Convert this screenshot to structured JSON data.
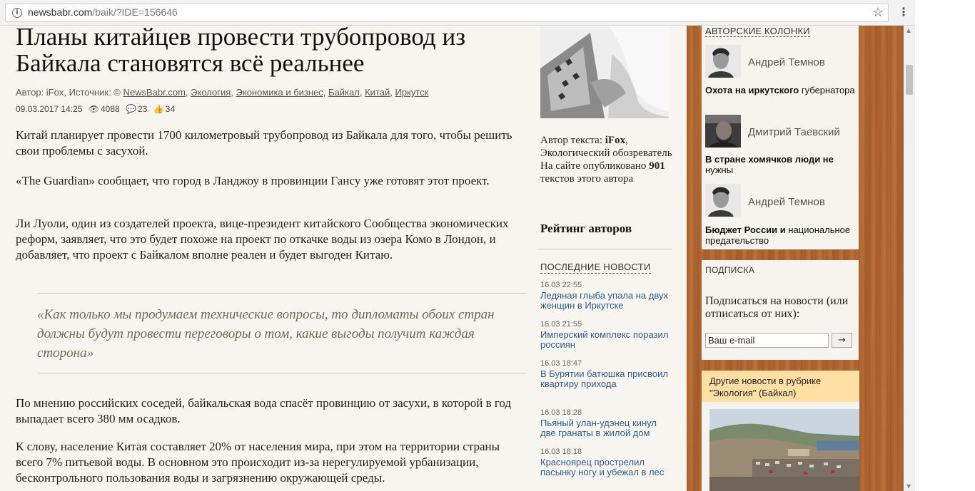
{
  "browser": {
    "url_host": "newsbabr.com",
    "url_path": "/baik/?IDE=156646",
    "info_icon": "info-icon",
    "star_icon": "star-icon",
    "menu_icon": "kebab-menu-icon"
  },
  "article": {
    "title": "Планы китайцев провести трубопровод из Байкала становятся всё реальнее",
    "meta_prefix": "Автор: iFox, Источник: © ",
    "source": "NewsBabr.com",
    "tags": [
      "Экология",
      "Экономика и бизнес",
      "Байкал",
      "Китай",
      "Иркутск"
    ],
    "date": "09.03.2017 14:25",
    "views": "4088",
    "comments": "23",
    "likes": "34",
    "paragraphs": [
      "Китай планирует провести 1700 километровый трубопровод из Байкала для того, чтобы решить свои проблемы с засухой.",
      "«The Guardian» сообщает, что город в Ланджоу в провинции Гансу уже готовят этот проект.",
      "Ли Луоли, один из создателей проекта, вице-президент китайского Сообщества экономических реформ, заявляет, что это будет похоже на проект по откачке воды из озера Комо в Лондон, и добавляет, что проект с Байкалом вполне реален и будет выгоден Китаю.",
      "По мнению российских соседей, байкальская вода спасёт провинцию от засухи, в которой в год выпадает всего 380 мм осадков.",
      "К слову, население Китая составляет 20% от населения мира, при этом на территории страны всего 7% питьевой воды. В основном это происходит из-за нерегулируемой урбанизации, бесконтрольного пользования воды и загрязнению окружающей среды."
    ],
    "quote": "«Как только мы продумаем технические вопросы, то дипломаты обоих стран должны будут провести переговоры о том, какие выгоды получит каждая сторона»"
  },
  "author_box": {
    "label": "Автор текста: ",
    "name": "iFox",
    "role": "Экологический обозреватель",
    "published_prefix": "На сайте опубликовано ",
    "count": "901",
    "published_suffix": " текстов этого автора",
    "rating_link": "Рейтинг авторов"
  },
  "latest_news": {
    "heading": "ПОСЛЕДНИЕ НОВОСТИ",
    "items": [
      {
        "time": "16.03 22:55",
        "title": "Ледяная глыба упала на двух женщин в Иркутске"
      },
      {
        "time": "16.03 21:55",
        "title": "Имперский комплекс поразил россиян"
      },
      {
        "time": "16.03 18:47",
        "title": "В Бурятии батюшка присвоил квартиру прихода"
      },
      {
        "time": "16.03 18:28",
        "title": "Пьяный улан-удэнец кинул две гранаты в жилой дом"
      },
      {
        "time": "16.03 18:18",
        "title": "Красноярец прострелил пасынку ногу и убежал в лес"
      }
    ]
  },
  "columns": {
    "heading": "АВТОРСКИЕ КОЛОНКИ",
    "items": [
      {
        "author": "Андрей Темнов",
        "title_bold": "Охота на иркутского",
        "title_rest": " губернатора"
      },
      {
        "author": "Дмитрий Таевский",
        "title_bold": "В стране хомячков люди не",
        "title_rest": " нужны"
      },
      {
        "author": "Андрей Темнов",
        "title_bold": "Бюджет России и",
        "title_rest": " национальное предательство"
      }
    ]
  },
  "subscribe": {
    "heading": "ПОДПИСКА",
    "text": "Подписаться на новости (или отписаться от них):",
    "email_value": "Ваш e-mail",
    "submit_label": "→"
  },
  "rubric": {
    "title": "Другие новости в рубрике \"Экология\" (Байкал)"
  }
}
